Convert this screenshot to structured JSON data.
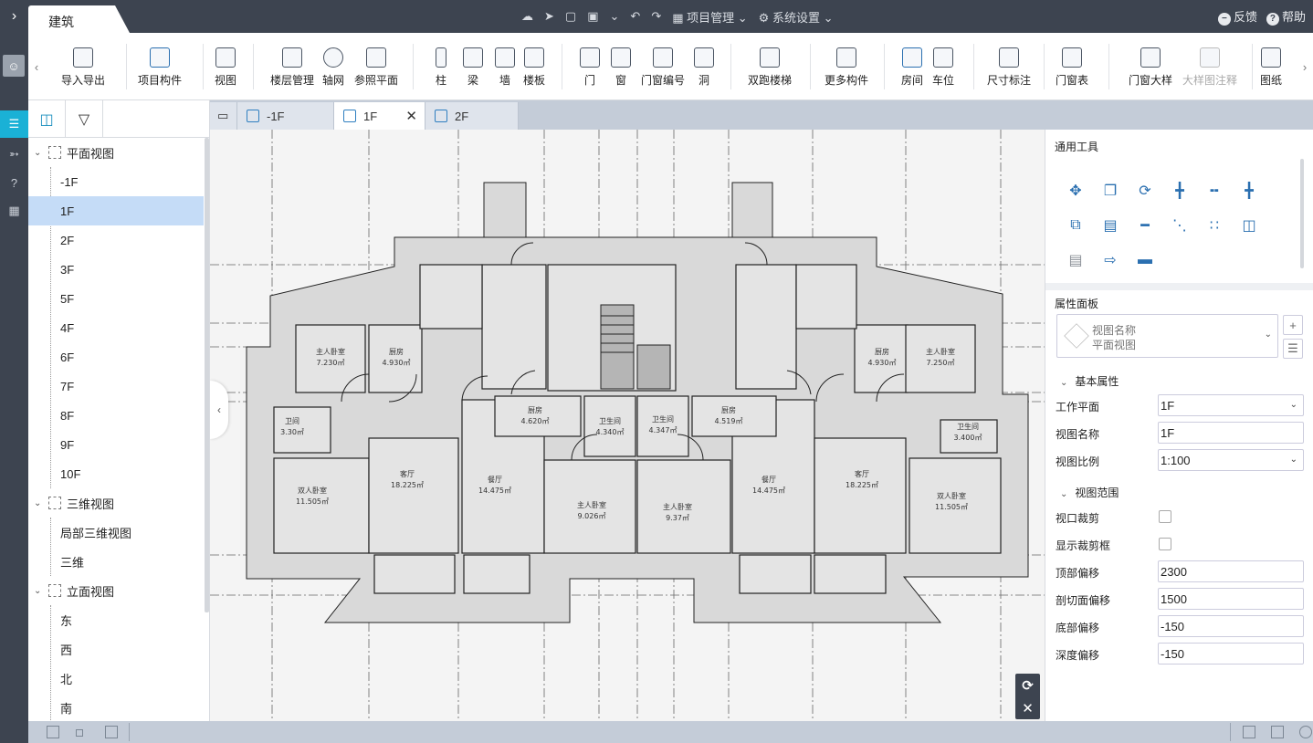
{
  "app": {
    "active_tab": "建筑",
    "menus": {
      "project": "项目管理",
      "settings": "系统设置"
    },
    "feedback": "反馈",
    "help": "帮助"
  },
  "ribbon": {
    "items": [
      {
        "label": "导入导出",
        "icon": "cad-icon"
      },
      {
        "label": "项目构件",
        "icon": "component-icon"
      },
      {
        "label": "视图",
        "icon": "view-icon"
      },
      {
        "label": "楼层管理",
        "icon": "floor-icon"
      },
      {
        "label": "轴网",
        "icon": "axis-grid-icon"
      },
      {
        "label": "参照平面",
        "icon": "reference-plane-icon"
      },
      {
        "label": "柱",
        "icon": "column-icon"
      },
      {
        "label": "梁",
        "icon": "beam-icon"
      },
      {
        "label": "墙",
        "icon": "wall-icon"
      },
      {
        "label": "楼板",
        "icon": "slab-icon"
      },
      {
        "label": "门",
        "icon": "door-icon"
      },
      {
        "label": "窗",
        "icon": "window-icon"
      },
      {
        "label": "门窗编号",
        "icon": "door-window-tag-icon"
      },
      {
        "label": "洞",
        "icon": "opening-icon"
      },
      {
        "label": "双跑楼梯",
        "icon": "stair-icon"
      },
      {
        "label": "更多构件",
        "icon": "more-components-icon"
      },
      {
        "label": "房间",
        "icon": "room-icon"
      },
      {
        "label": "车位",
        "icon": "parking-icon"
      },
      {
        "label": "尺寸标注",
        "icon": "dimension-icon"
      },
      {
        "label": "门窗表",
        "icon": "schedule-icon"
      },
      {
        "label": "门窗大样",
        "icon": "detail-icon"
      },
      {
        "label": "大样图注释",
        "icon": "detail-annotation-icon"
      },
      {
        "label": "图纸",
        "icon": "sheet-icon"
      }
    ]
  },
  "tree": {
    "groups": [
      {
        "label": "平面视图",
        "items": [
          "-1F",
          "1F",
          "2F",
          "3F",
          "5F",
          "4F",
          "6F",
          "7F",
          "8F",
          "9F",
          "10F"
        ]
      },
      {
        "label": "三维视图",
        "items": [
          "局部三维视图",
          "三维"
        ]
      },
      {
        "label": "立面视图",
        "items": [
          "东",
          "西",
          "北",
          "南"
        ]
      }
    ],
    "selected": "1F"
  },
  "doc_tabs": [
    "-1F",
    "1F",
    "2F"
  ],
  "plan": {
    "rooms": [
      {
        "name": "主人卧室",
        "area": "7.230㎡"
      },
      {
        "name": "厨房",
        "area": "4.930㎡"
      },
      {
        "name": "厨房",
        "area": "4.930㎡"
      },
      {
        "name": "主人卧室",
        "area": "7.250㎡"
      },
      {
        "name": "卫间",
        "area": "3.30㎡"
      },
      {
        "name": "卫生间",
        "area": "3.400㎡"
      },
      {
        "name": "厨房",
        "area": "4.620㎡"
      },
      {
        "name": "卫生间",
        "area": "4.340㎡"
      },
      {
        "name": "卫生间",
        "area": "4.347㎡"
      },
      {
        "name": "厨房",
        "area": "4.519㎡"
      },
      {
        "name": "双人卧室",
        "area": "11.505㎡"
      },
      {
        "name": "客厅",
        "area": "18.225㎡"
      },
      {
        "name": "餐厅",
        "area": "14.475㎡"
      },
      {
        "name": "主人卧室",
        "area": "9.026㎡"
      },
      {
        "name": "主人卧室",
        "area": "9.37㎡"
      },
      {
        "name": "餐厅",
        "area": "14.475㎡"
      },
      {
        "name": "客厅",
        "area": "18.225㎡"
      },
      {
        "name": "双人卧室",
        "area": "11.505㎡"
      }
    ]
  },
  "right_panel": {
    "tools_title": "通用工具",
    "tools": [
      "move-icon",
      "copy-icon",
      "rotate-icon",
      "align-icon",
      "split-icon",
      "trim-icon",
      "offset-icon",
      "align-right-icon",
      "extend-icon",
      "array-icon",
      "grid-array-icon",
      "mirror-icon",
      "delete-icon",
      "match-icon",
      "measure-icon"
    ],
    "props_title": "属性面板",
    "view_name_label": "视图名称",
    "view_name_value": "平面视图",
    "basic_section": "基本属性",
    "work_plane_label": "工作平面",
    "work_plane_value": "1F",
    "view_name_field_label": "视图名称",
    "view_name_field_value": "1F",
    "scale_label": "视图比例",
    "scale_value": "1:100",
    "range_section": "视图范围",
    "crop_label": "视口裁剪",
    "show_crop_label": "显示裁剪框",
    "top_offset_label": "顶部偏移",
    "top_offset_value": "2300",
    "cut_offset_label": "剖切面偏移",
    "cut_offset_value": "1500",
    "bottom_offset_label": "底部偏移",
    "bottom_offset_value": "-150",
    "depth_offset_label": "深度偏移",
    "depth_offset_value": "-150"
  }
}
